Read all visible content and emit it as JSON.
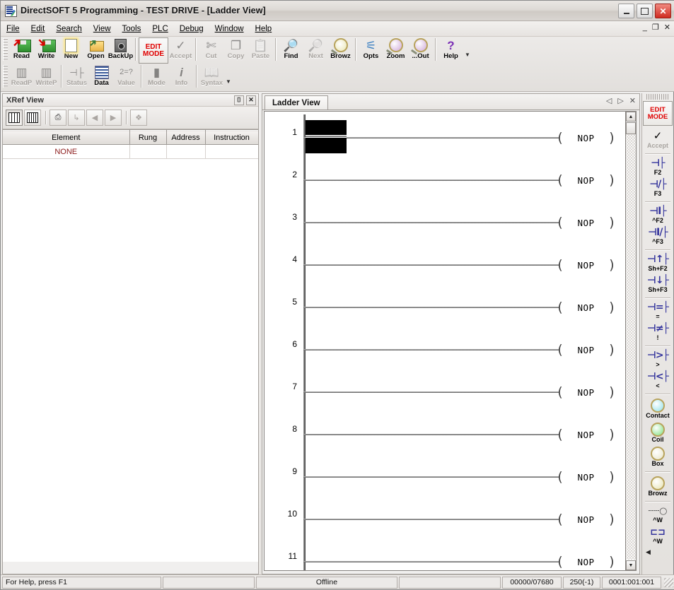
{
  "window": {
    "title": "DirectSOFT 5 Programming - TEST DRIVE - [Ladder View]",
    "app_icon": "directsoft-icon",
    "minimize": "_",
    "maximize": "▣",
    "close": "✕"
  },
  "mdi_buttons": {
    "minimize": "_",
    "restore": "❐",
    "close": "✕"
  },
  "menu": [
    {
      "label": "File",
      "accel": "F"
    },
    {
      "label": "Edit",
      "accel": "E"
    },
    {
      "label": "Search",
      "accel": "S"
    },
    {
      "label": "View",
      "accel": "V"
    },
    {
      "label": "Tools",
      "accel": "T"
    },
    {
      "label": "PLC",
      "accel": "P"
    },
    {
      "label": "Debug",
      "accel": "D"
    },
    {
      "label": "Window",
      "accel": "W"
    },
    {
      "label": "Help",
      "accel": "H"
    }
  ],
  "toolbar": {
    "row1": [
      {
        "label": "Read",
        "icon": "read-disk-icon",
        "enabled": true
      },
      {
        "label": "Write",
        "icon": "write-disk-icon",
        "enabled": true
      },
      {
        "label": "New",
        "icon": "new-document-icon",
        "enabled": true
      },
      {
        "label": "Open",
        "icon": "open-folder-icon",
        "enabled": true
      },
      {
        "label": "BackUp",
        "icon": "safe-backup-icon",
        "enabled": true
      },
      {
        "label": "EDIT MODE",
        "icon": "edit-mode-icon",
        "enabled": true,
        "type": "editmode"
      },
      {
        "label": "Accept",
        "icon": "accept-check-icon",
        "enabled": false
      },
      {
        "label": "Cut",
        "icon": "scissors-icon",
        "enabled": false
      },
      {
        "label": "Copy",
        "icon": "copy-pages-icon",
        "enabled": false
      },
      {
        "label": "Paste",
        "icon": "paste-glue-icon",
        "enabled": false
      },
      {
        "label": "Find",
        "icon": "find-binoculars-icon",
        "enabled": true
      },
      {
        "label": "Next",
        "icon": "find-next-icon",
        "enabled": false
      },
      {
        "label": "Browz",
        "icon": "browse-x-icon",
        "enabled": true
      },
      {
        "label": "Opts",
        "icon": "options-icon",
        "enabled": true
      },
      {
        "label": "Zoom",
        "icon": "zoom-in-icon",
        "enabled": true
      },
      {
        "label": "...Out",
        "icon": "zoom-out-icon",
        "enabled": true
      },
      {
        "label": "Help",
        "icon": "help-question-icon",
        "enabled": true
      }
    ],
    "row2": [
      {
        "label": "ReadP",
        "icon": "read-program-icon",
        "enabled": false
      },
      {
        "label": "WriteP",
        "icon": "write-program-icon",
        "enabled": false
      },
      {
        "label": "Status",
        "icon": "status-contacts-icon",
        "enabled": false
      },
      {
        "label": "Data",
        "icon": "data-view-icon",
        "enabled": true
      },
      {
        "label": "Value",
        "icon": "value-query-icon",
        "enabled": false
      },
      {
        "label": "Mode",
        "icon": "mode-icon",
        "enabled": false
      },
      {
        "label": "Info",
        "icon": "info-icon",
        "enabled": false
      },
      {
        "label": "Syntax",
        "icon": "syntax-check-icon",
        "enabled": false
      }
    ],
    "dropdown_caret": "▼"
  },
  "xref": {
    "title": "XRef View",
    "pin_icon": "pushpin-icon",
    "close_icon": "close-icon",
    "tools": [
      {
        "name": "grid-view-button",
        "icon": "grid-large-icon",
        "enabled": true,
        "active": true
      },
      {
        "name": "list-view-button",
        "icon": "grid-small-icon",
        "enabled": true,
        "active": false
      },
      {
        "name": "print-button",
        "icon": "printer-icon",
        "enabled": true,
        "active": false
      },
      {
        "name": "goto-button",
        "icon": "goto-arrow-icon",
        "enabled": false,
        "active": false
      },
      {
        "name": "previous-button",
        "icon": "left-arrow-icon",
        "enabled": false,
        "active": false
      },
      {
        "name": "next-button",
        "icon": "right-arrow-icon",
        "enabled": false,
        "active": false
      },
      {
        "name": "stack-button",
        "icon": "layers-icon",
        "enabled": false,
        "active": false
      }
    ],
    "columns": [
      "Element",
      "Rung",
      "Address",
      "Instruction"
    ],
    "rows": [
      {
        "element": "NONE",
        "rung": "",
        "address": "",
        "instruction": ""
      }
    ]
  },
  "ladder": {
    "tab_label": "Ladder View",
    "nav": {
      "prev": "◁",
      "next": "▷",
      "close": "✕"
    },
    "scrollbar": {
      "up": "▲",
      "down": "▼"
    },
    "rungs": [
      {
        "number": "1",
        "instruction": "NOP",
        "selected": true
      },
      {
        "number": "2",
        "instruction": "NOP",
        "selected": false
      },
      {
        "number": "3",
        "instruction": "NOP",
        "selected": false
      },
      {
        "number": "4",
        "instruction": "NOP",
        "selected": false
      },
      {
        "number": "5",
        "instruction": "NOP",
        "selected": false
      },
      {
        "number": "6",
        "instruction": "NOP",
        "selected": false
      },
      {
        "number": "7",
        "instruction": "NOP",
        "selected": false
      },
      {
        "number": "8",
        "instruction": "NOP",
        "selected": false
      },
      {
        "number": "9",
        "instruction": "NOP",
        "selected": false
      },
      {
        "number": "10",
        "instruction": "NOP",
        "selected": false
      },
      {
        "number": "11",
        "instruction": "NOP",
        "selected": false
      }
    ],
    "coil_open": "(",
    "coil_close": ")"
  },
  "right_panel": {
    "edit_mode": {
      "line1": "EDIT",
      "line2": "MODE"
    },
    "items": [
      {
        "name": "accept-button",
        "symbol": "✓",
        "key": "Accept",
        "icon": "accept-check-icon",
        "enabled": false,
        "type": "icon"
      },
      {
        "name": "normally-open-contact",
        "symbol": "⊣├",
        "key": "F2",
        "enabled": true
      },
      {
        "name": "normally-closed-contact",
        "symbol": "⊣/├",
        "key": "F3",
        "enabled": true
      },
      {
        "name": "immediate-contact",
        "symbol": "⊣I├",
        "key": "^F2",
        "enabled": true
      },
      {
        "name": "immediate-not-contact",
        "symbol": "⊣I/├",
        "key": "^F3",
        "enabled": true
      },
      {
        "name": "rising-edge-contact",
        "symbol": "⊣↑├",
        "key": "Sh+F2",
        "enabled": true
      },
      {
        "name": "falling-edge-contact",
        "symbol": "⊣↓├",
        "key": "Sh+F3",
        "enabled": true
      },
      {
        "name": "equal-compare-contact",
        "symbol": "⊣=├",
        "key": "=",
        "enabled": true
      },
      {
        "name": "not-equal-compare-contact",
        "symbol": "⊣≠├",
        "key": "!",
        "enabled": true
      },
      {
        "name": "greater-than-contact",
        "symbol": "⊣>├",
        "key": ">",
        "enabled": true
      },
      {
        "name": "less-than-contact",
        "symbol": "⊣<├",
        "key": "<",
        "enabled": true
      },
      {
        "name": "contact-browser-button",
        "symbol": "◉",
        "key": "Contact",
        "icon": "contact-magnifier-icon",
        "enabled": true,
        "type": "icon"
      },
      {
        "name": "coil-browser-button",
        "symbol": "◉",
        "key": "Coil",
        "icon": "coil-magnifier-icon",
        "enabled": true,
        "type": "icon"
      },
      {
        "name": "box-browser-button",
        "symbol": "▢",
        "key": "Box",
        "icon": "box-magnifier-icon",
        "enabled": true,
        "type": "icon"
      },
      {
        "name": "browz-button",
        "symbol": "Ⓧ",
        "key": "Browz",
        "icon": "browse-x-icon",
        "enabled": true,
        "type": "icon"
      },
      {
        "name": "wire-node-button",
        "symbol": "⊷",
        "key": "^W",
        "enabled": true
      },
      {
        "name": "wire-branch-button",
        "symbol": "⊐",
        "key": "^W",
        "enabled": true
      }
    ],
    "scroll_left": "◀"
  },
  "statusbar": {
    "help_text": "For Help, press F1",
    "field2": "",
    "connection": "Offline",
    "field4": "",
    "memory": "00000/07680",
    "scan": "250(-1)",
    "position": "0001:001:001"
  }
}
